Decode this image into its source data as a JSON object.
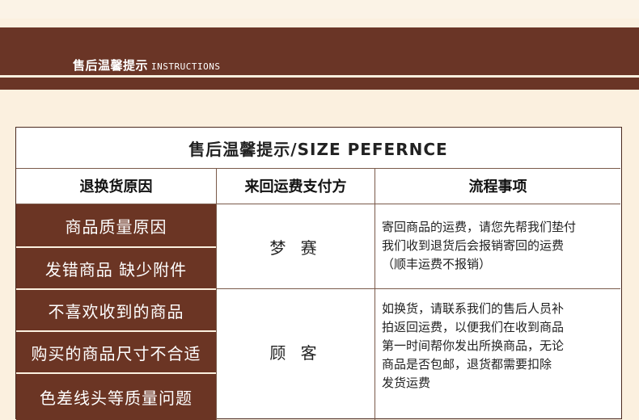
{
  "banner": {
    "title_cn": "售后温馨提示",
    "title_en": "INSTRUCTIONS"
  },
  "table": {
    "title": "售后温馨提示/SIZE PEFERNCE",
    "headers": [
      "退换货原因",
      "来回运费支付方",
      "流程事项"
    ],
    "reasons": [
      "商品质量原因",
      "发错商品 缺少附件",
      "不喜欢收到的商品",
      "购买的商品尺寸不合适",
      "色差线头等质量问题"
    ],
    "groups": [
      {
        "payer": "梦 赛",
        "process": [
          "寄回商品的运费，请您先帮我们垫付",
          "我们收到退货后会报销寄回的运费",
          "（顺丰运费不报销）"
        ]
      },
      {
        "payer": "顾 客",
        "process": [
          "如换货，请联系我们的售后人员补",
          "拍返回运费，以便我们在收到商品",
          "第一时间帮你发出所换商品，无论",
          "商品是否包邮，退货都需要扣除",
          "发货运费"
        ]
      }
    ]
  },
  "colors": {
    "brand_brown": "#6a3526",
    "background": "#fbf0df"
  }
}
